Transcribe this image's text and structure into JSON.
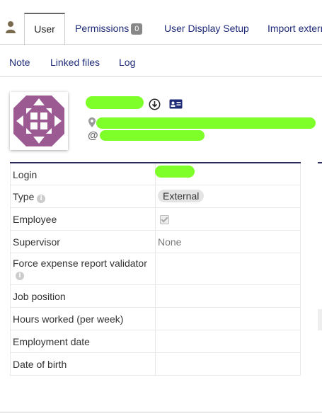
{
  "tabs": {
    "user": "User",
    "permissions": "Permissions",
    "permissions_count": "0",
    "display": "User Display Setup",
    "import": "Import extern"
  },
  "subtabs": {
    "note": "Note",
    "files": "Linked files",
    "log": "Log"
  },
  "fields": [
    {
      "label": "Login",
      "value": ""
    },
    {
      "label": "Type",
      "value": "External"
    },
    {
      "label": "Employee",
      "value": ""
    },
    {
      "label": "Supervisor",
      "value": "None"
    },
    {
      "label": "Force expense report validator",
      "value": ""
    },
    {
      "label": "Job position",
      "value": ""
    },
    {
      "label": "Hours worked (per week)",
      "value": ""
    },
    {
      "label": "Employment date",
      "value": ""
    },
    {
      "label": "Date of birth",
      "value": ""
    }
  ],
  "employee_checked": true,
  "colors": {
    "link": "#1e2a78",
    "avatar": "#9b5b92",
    "redaction": "#7fff2a",
    "header_rule": "#2c2c5c"
  }
}
